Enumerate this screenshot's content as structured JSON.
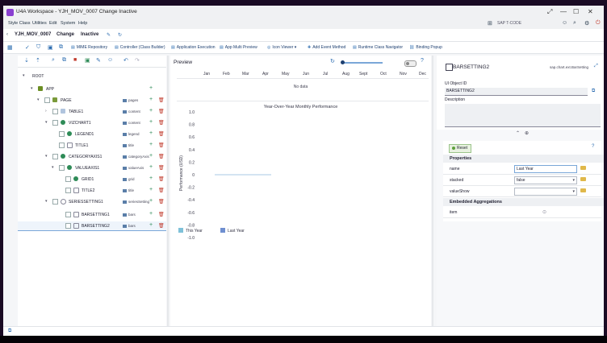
{
  "window": {
    "title": "U4A Workspace - YJH_MOV_0007 Change Inactive",
    "controls": [
      "⤢",
      "—",
      "☐",
      "✕"
    ]
  },
  "menubar": {
    "items": [
      "Style Class",
      "Utilities",
      "Edit",
      "System",
      "Help"
    ],
    "tcode_placeholder": "SAP T-CODE"
  },
  "header": {
    "app_id": "YJH_MOV_0007",
    "mode": "Change",
    "status": "Inactive"
  },
  "toolbar": {
    "buttons": [
      {
        "label": "MIME Repository",
        "icon": "folder-icon"
      },
      {
        "label": "Controller (Class Builder)",
        "icon": "class-builder-icon"
      },
      {
        "label": "Application Execution",
        "icon": "run-icon"
      },
      {
        "label": "App Multi Preview",
        "icon": "preview-icon"
      },
      {
        "label": "Icon Viewer",
        "icon": "icon-viewer-icon"
      },
      {
        "label": "Add Event Method",
        "icon": "add-event-icon"
      },
      {
        "label": "Runtime Class Navigator",
        "icon": "navigator-icon"
      },
      {
        "label": "Binding Popup",
        "icon": "binding-icon"
      }
    ]
  },
  "tree": {
    "rows": [
      {
        "label": "ROOT",
        "type": ""
      },
      {
        "label": "APP",
        "type": ""
      },
      {
        "label": "PAGE",
        "type": "pages"
      },
      {
        "label": "TABLE1",
        "type": "content"
      },
      {
        "label": "VIZCHART1",
        "type": "content"
      },
      {
        "label": "LEGEND1",
        "type": "legend"
      },
      {
        "label": "TITLE1",
        "type": "title"
      },
      {
        "label": "CATEGORYAXIS1",
        "type": "categoryAxis"
      },
      {
        "label": "VALUEAXIS1",
        "type": "valueAxis"
      },
      {
        "label": "GRID1",
        "type": "grid"
      },
      {
        "label": "TITLE2",
        "type": "title"
      },
      {
        "label": "SERIESSETTING1",
        "type": "seriesSetting"
      },
      {
        "label": "BARSETTING1",
        "type": "bars"
      },
      {
        "label": "BARSETTING2",
        "type": "bars"
      }
    ]
  },
  "preview": {
    "title": "Preview",
    "months": [
      "Jan",
      "Feb",
      "Mar",
      "Apr",
      "May",
      "Jun",
      "Jul",
      "Aug",
      "Sept",
      "Oct",
      "Nov",
      "Dec"
    ],
    "no_data": "No data",
    "chart_title": "Year-Over-Year Monthly Performance",
    "y_axis_label": "Performance (USD)",
    "y_ticks": [
      "1.0",
      "0.8",
      "0.6",
      "0.4",
      "0.2",
      "0",
      "-0.2",
      "-0.4",
      "-0.6",
      "-0.8",
      "-1.0"
    ],
    "legend": [
      "This Year",
      "Last Year"
    ]
  },
  "chart_data": {
    "type": "bar",
    "title": "Year-Over-Year Monthly Performance",
    "ylabel": "Performance (USD)",
    "ylim": [
      -1.0,
      1.0
    ],
    "series": [
      {
        "name": "This Year",
        "values": []
      },
      {
        "name": "Last Year",
        "values": []
      }
    ],
    "colors": [
      "#7fc1d9",
      "#6f8fd0"
    ],
    "legend_position": "bottom-left"
  },
  "properties_panel": {
    "object_name": "BARSETTING2",
    "object_type": "sap.chart.ext.BarSetting",
    "ui_object_id_label": "UI Object ID",
    "ui_object_id": "BARSETTING2",
    "description_label": "Description",
    "reset_label": "Reset",
    "properties_header": "Properties",
    "properties": [
      {
        "name": "name",
        "value": "Last Year",
        "kind": "input"
      },
      {
        "name": "stacked",
        "value": "false",
        "kind": "select"
      },
      {
        "name": "valueShow",
        "value": "",
        "kind": "select"
      }
    ],
    "aggregations_header": "Embedded Aggregations",
    "aggregations": [
      {
        "name": "item"
      }
    ]
  }
}
